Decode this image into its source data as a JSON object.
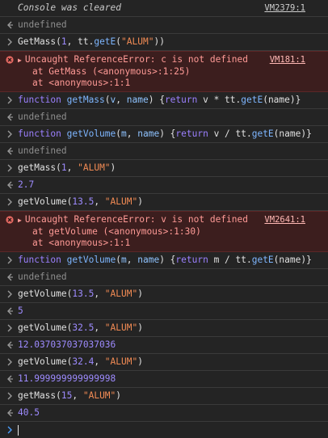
{
  "rows": [
    {
      "type": "info",
      "text": "Console was cleared",
      "source": "VM2379:1"
    },
    {
      "type": "result",
      "text": "undefined"
    },
    {
      "type": "input",
      "parts": [
        [
          "plain",
          "GetMass("
        ],
        [
          "num",
          "1"
        ],
        [
          "plain",
          ", tt."
        ],
        [
          "fn",
          "getE"
        ],
        [
          "plain",
          "("
        ],
        [
          "str",
          "\"ALUM\""
        ],
        [
          "plain",
          "))"
        ]
      ]
    },
    {
      "type": "error",
      "lines": [
        "Uncaught ReferenceError: c is not defined",
        "at GetMass (<anonymous>:1:25)",
        "at <anonymous>:1:1"
      ],
      "source": "VM181:1"
    },
    {
      "type": "input",
      "parts": [
        [
          "kw",
          "function "
        ],
        [
          "fn",
          "getMass"
        ],
        [
          "plain",
          "("
        ],
        [
          "param",
          "v"
        ],
        [
          "plain",
          ", "
        ],
        [
          "param",
          "name"
        ],
        [
          "plain",
          ") {"
        ],
        [
          "kw",
          "return"
        ],
        [
          "plain",
          " v * tt."
        ],
        [
          "fn",
          "getE"
        ],
        [
          "plain",
          "(name)}"
        ]
      ]
    },
    {
      "type": "result",
      "text": "undefined"
    },
    {
      "type": "input",
      "parts": [
        [
          "kw",
          "function "
        ],
        [
          "fn",
          "getVolume"
        ],
        [
          "plain",
          "("
        ],
        [
          "param",
          "m"
        ],
        [
          "plain",
          ", "
        ],
        [
          "param",
          "name"
        ],
        [
          "plain",
          ") {"
        ],
        [
          "kw",
          "return"
        ],
        [
          "plain",
          " v / tt."
        ],
        [
          "fn",
          "getE"
        ],
        [
          "plain",
          "(name)}"
        ]
      ]
    },
    {
      "type": "result",
      "text": "undefined"
    },
    {
      "type": "input",
      "parts": [
        [
          "plain",
          "getMass("
        ],
        [
          "num",
          "1"
        ],
        [
          "plain",
          ", "
        ],
        [
          "str",
          "\"ALUM\""
        ],
        [
          "plain",
          ")"
        ]
      ]
    },
    {
      "type": "result-num",
      "text": "2.7"
    },
    {
      "type": "input",
      "parts": [
        [
          "plain",
          "getVolume("
        ],
        [
          "num",
          "13.5"
        ],
        [
          "plain",
          ", "
        ],
        [
          "str",
          "\"ALUM\""
        ],
        [
          "plain",
          ")"
        ]
      ]
    },
    {
      "type": "error",
      "lines": [
        "Uncaught ReferenceError: v is not defined",
        "at getVolume (<anonymous>:1:30)",
        "at <anonymous>:1:1"
      ],
      "source": "VM2641:1"
    },
    {
      "type": "input",
      "parts": [
        [
          "kw",
          "function "
        ],
        [
          "fn",
          "getVolume"
        ],
        [
          "plain",
          "("
        ],
        [
          "param",
          "m"
        ],
        [
          "plain",
          ", "
        ],
        [
          "param",
          "name"
        ],
        [
          "plain",
          ") {"
        ],
        [
          "kw",
          "return"
        ],
        [
          "plain",
          " m / tt."
        ],
        [
          "fn",
          "getE"
        ],
        [
          "plain",
          "(name)}"
        ]
      ]
    },
    {
      "type": "result",
      "text": "undefined"
    },
    {
      "type": "input",
      "parts": [
        [
          "plain",
          "getVolume("
        ],
        [
          "num",
          "13.5"
        ],
        [
          "plain",
          ", "
        ],
        [
          "str",
          "\"ALUM\""
        ],
        [
          "plain",
          ")"
        ]
      ]
    },
    {
      "type": "result-num",
      "text": "5"
    },
    {
      "type": "input",
      "parts": [
        [
          "plain",
          "getVolume("
        ],
        [
          "num",
          "32.5"
        ],
        [
          "plain",
          ", "
        ],
        [
          "str",
          "\"ALUM\""
        ],
        [
          "plain",
          ")"
        ]
      ]
    },
    {
      "type": "result-num",
      "text": "12.037037037037036"
    },
    {
      "type": "input",
      "parts": [
        [
          "plain",
          "getVolume("
        ],
        [
          "num",
          "32.4"
        ],
        [
          "plain",
          ", "
        ],
        [
          "str",
          "\"ALUM\""
        ],
        [
          "plain",
          ")"
        ]
      ]
    },
    {
      "type": "result-num",
      "text": "11.999999999999998"
    },
    {
      "type": "input",
      "parts": [
        [
          "plain",
          "getMass("
        ],
        [
          "num",
          "15"
        ],
        [
          "plain",
          ", "
        ],
        [
          "str",
          "\"ALUM\""
        ],
        [
          "plain",
          ")"
        ]
      ]
    },
    {
      "type": "result-num",
      "text": "40.5"
    }
  ],
  "colors": {
    "input_chevron": "#9a9a9a",
    "prompt_chevron": "#4a9eff",
    "error_icon": "#e46962"
  }
}
